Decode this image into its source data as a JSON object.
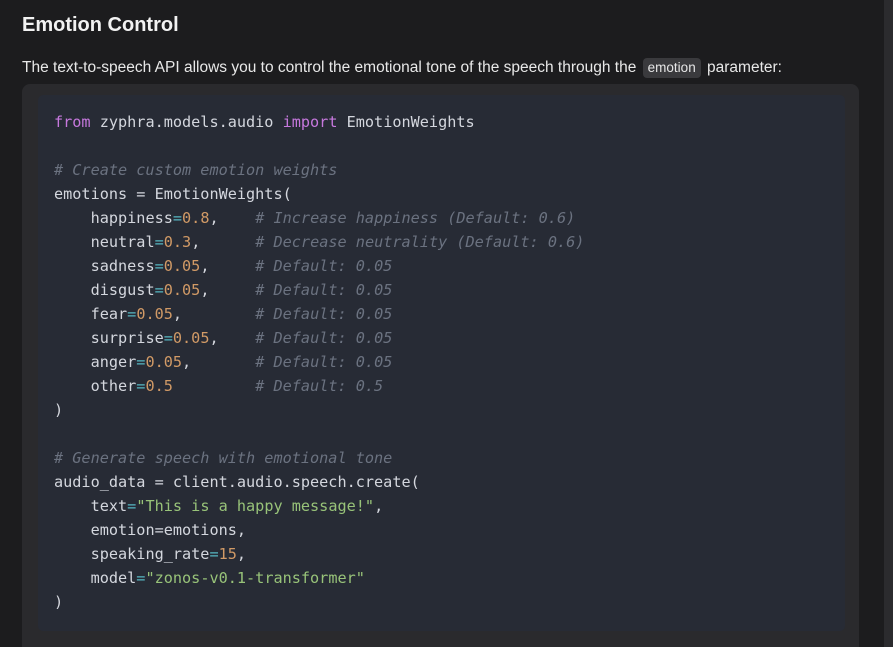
{
  "heading": "Emotion Control",
  "intro": {
    "before": "The text-to-speech API allows you to control the emotional tone of the speech through the",
    "code": "emotion",
    "after": "parameter:"
  },
  "code": {
    "line1": {
      "kw1": "from",
      "module": " zyphra.models.audio ",
      "kw2": "import",
      "name": " EmotionWeights"
    },
    "line3": {
      "comment": "# Create custom emotion weights"
    },
    "line4": {
      "text": "emotions = EmotionWeights("
    },
    "weights": [
      {
        "param": "happiness",
        "value": "0.8",
        "sep": ",",
        "pad": "    ",
        "comment": "# Increase happiness (Default: 0.6)"
      },
      {
        "param": "neutral",
        "value": "0.3",
        "sep": ",",
        "pad": "      ",
        "comment": "# Decrease neutrality (Default: 0.6)"
      },
      {
        "param": "sadness",
        "value": "0.05",
        "sep": ",",
        "pad": "     ",
        "comment": "# Default: 0.05"
      },
      {
        "param": "disgust",
        "value": "0.05",
        "sep": ",",
        "pad": "     ",
        "comment": "# Default: 0.05"
      },
      {
        "param": "fear",
        "value": "0.05",
        "sep": ",",
        "pad": "        ",
        "comment": "# Default: 0.05"
      },
      {
        "param": "surprise",
        "value": "0.05",
        "sep": ",",
        "pad": "    ",
        "comment": "# Default: 0.05"
      },
      {
        "param": "anger",
        "value": "0.05",
        "sep": ",",
        "pad": "       ",
        "comment": "# Default: 0.05"
      },
      {
        "param": "other",
        "value": "0.5",
        "sep": "",
        "pad": "         ",
        "comment": "# Default: 0.5"
      }
    ],
    "close1": ")",
    "line16": {
      "comment": "# Generate speech with emotional tone"
    },
    "line17": {
      "text": "audio_data = client.audio.speech.create("
    },
    "line18": {
      "param": "text",
      "value": "\"This is a happy message!\"",
      "sep": ","
    },
    "line19": {
      "text": "emotion=emotions,"
    },
    "line20": {
      "param": "speaking_rate",
      "value": "15",
      "sep": ","
    },
    "line21": {
      "param": "model",
      "value": "\"zonos-v0.1-transformer\""
    },
    "close2": ")"
  },
  "colors": {
    "keyword": "#c678dd",
    "number": "#d19a66",
    "string": "#98c379",
    "comment": "#6b7280",
    "code_bg": "#272b35"
  }
}
